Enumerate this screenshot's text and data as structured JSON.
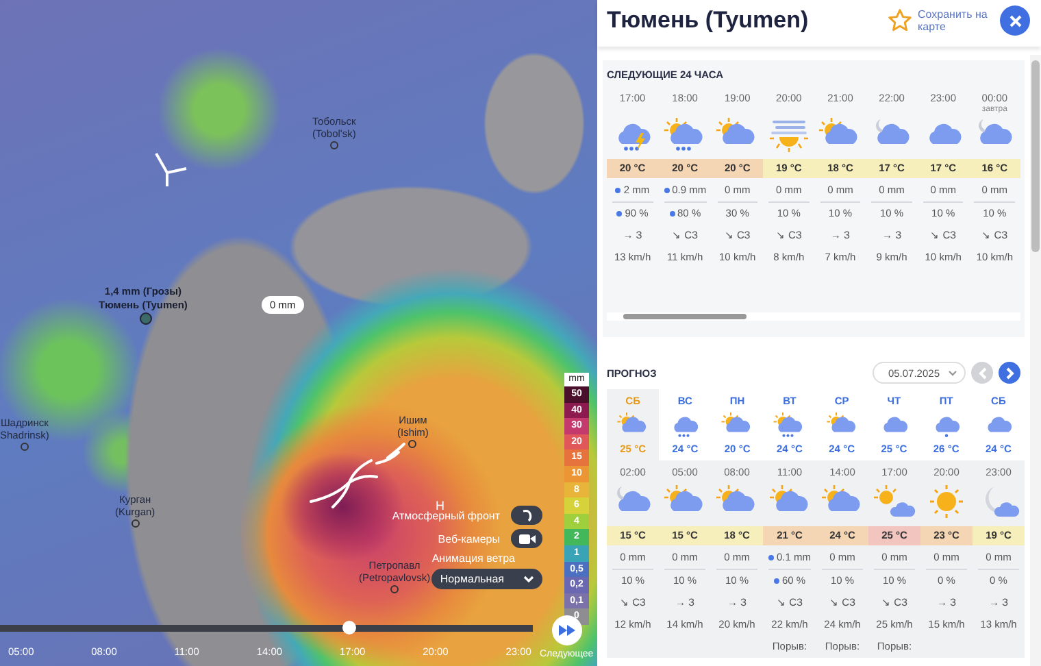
{
  "map": {
    "cities": [
      {
        "name": "Тобольск",
        "latin": "(Tobol'sk)"
      },
      {
        "name": "Ишим",
        "latin": "(Ishim)"
      },
      {
        "name": "Курган",
        "latin": "(Kurgan)"
      },
      {
        "name": "Шадринск",
        "latin": "Shadrinsk)"
      },
      {
        "name": "Петропавл",
        "latin": "(Petropavlovsk)"
      }
    ],
    "point": {
      "value": "1,4 mm (Грозы)",
      "name": "Тюмень (Tyumen)"
    },
    "bubble": "0 mm",
    "pressure_mark": "Н",
    "legend": {
      "unit": "mm",
      "levels": [
        {
          "label": "50",
          "color": "#4a0f2a"
        },
        {
          "label": "40",
          "color": "#8e1b4f"
        },
        {
          "label": "30",
          "color": "#c53a6d"
        },
        {
          "label": "20",
          "color": "#e0585a"
        },
        {
          "label": "15",
          "color": "#e6733d"
        },
        {
          "label": "10",
          "color": "#eb9535"
        },
        {
          "label": "8",
          "color": "#e9b43a"
        },
        {
          "label": "6",
          "color": "#d6d23a"
        },
        {
          "label": "4",
          "color": "#9fcf3c"
        },
        {
          "label": "2",
          "color": "#43b85a"
        },
        {
          "label": "1",
          "color": "#3aa3b5"
        },
        {
          "label": "0,5",
          "color": "#4c6fc0"
        },
        {
          "label": "0,2",
          "color": "#6a68b0"
        },
        {
          "label": "0,1",
          "color": "#7a72a8"
        },
        {
          "label": "0",
          "color": "#8d8d92"
        }
      ]
    },
    "layers": [
      {
        "label": "Атмосферный фронт",
        "kind": "front"
      },
      {
        "label": "Веб-камеры",
        "kind": "camera"
      }
    ],
    "wind_animation": {
      "label": "Анимация ветра",
      "value": "Нормальная"
    },
    "timeline": {
      "ticks": [
        "05:00",
        "08:00",
        "11:00",
        "14:00",
        "17:00",
        "20:00",
        "23:00"
      ],
      "level": 0.655,
      "next_label": "Следующее"
    }
  },
  "panel": {
    "title": "Тюмень (Tyumen)",
    "save_link": "Сохранить на карте",
    "next24": {
      "title": "СЛЕДУЮЩИЕ 24 ЧАСА",
      "hours": [
        {
          "time": "17:00",
          "kind": "storm",
          "temp": "20 °C",
          "color": "#f5d6b4",
          "precip": "2 mm",
          "precip_drop": true,
          "prob": "90 %",
          "prob_drop": true,
          "wind": "→ З",
          "speed": "13 km/h"
        },
        {
          "time": "18:00",
          "kind": "sun-cloud-rain",
          "temp": "20 °C",
          "color": "#f5d6b4",
          "precip": "0.9 mm",
          "precip_drop": true,
          "prob": "80 %",
          "prob_drop": true,
          "wind": "↘ СЗ",
          "speed": "11 km/h"
        },
        {
          "time": "19:00",
          "kind": "sun-cloud",
          "temp": "20 °C",
          "color": "#f5d6b4",
          "precip": "0 mm",
          "precip_drop": false,
          "prob": "30 %",
          "prob_drop": false,
          "wind": "↘ СЗ",
          "speed": "10 km/h"
        },
        {
          "time": "20:00",
          "kind": "fog-sun",
          "temp": "19 °C",
          "color": "#f6eebb",
          "precip": "0 mm",
          "precip_drop": false,
          "prob": "10 %",
          "prob_drop": false,
          "wind": "↘ СЗ",
          "speed": "8 km/h"
        },
        {
          "time": "21:00",
          "kind": "sun-cloud",
          "temp": "18 °C",
          "color": "#f6eebb",
          "precip": "0 mm",
          "precip_drop": false,
          "prob": "10 %",
          "prob_drop": false,
          "wind": "→ З",
          "speed": "7 km/h"
        },
        {
          "time": "22:00",
          "kind": "moon-cloud",
          "temp": "17 °C",
          "color": "#f6eebb",
          "precip": "0 mm",
          "precip_drop": false,
          "prob": "10 %",
          "prob_drop": false,
          "wind": "→ З",
          "speed": "9 km/h"
        },
        {
          "time": "23:00",
          "kind": "cloud",
          "temp": "17 °C",
          "color": "#f6eebb",
          "precip": "0 mm",
          "precip_drop": false,
          "prob": "10 %",
          "prob_drop": false,
          "wind": "↘ СЗ",
          "speed": "10 km/h"
        },
        {
          "time": "00:00",
          "sub": "завтра",
          "kind": "moon-cloud",
          "temp": "16 °C",
          "color": "#f6eebb",
          "precip": "0 mm",
          "precip_drop": false,
          "prob": "10 %",
          "prob_drop": false,
          "wind": "↘ СЗ",
          "speed": "10 km/h"
        }
      ]
    },
    "forecast": {
      "title": "ПРОГНОЗ",
      "date": "05.07.2025",
      "prev_disabled": true,
      "days": [
        {
          "label": "СБ",
          "kind": "sun-cloud",
          "temp": "25 °C",
          "selected": true
        },
        {
          "label": "ВС",
          "kind": "cloud-rain",
          "temp": "24 °C",
          "selected": false
        },
        {
          "label": "ПН",
          "kind": "sun-cloud",
          "temp": "20 °C",
          "selected": false
        },
        {
          "label": "ВТ",
          "kind": "sun-cloud-rain",
          "temp": "24 °C",
          "selected": false
        },
        {
          "label": "СР",
          "kind": "sun-cloud",
          "temp": "24 °C",
          "selected": false
        },
        {
          "label": "ЧТ",
          "kind": "cloud",
          "temp": "25 °C",
          "selected": false
        },
        {
          "label": "ПТ",
          "kind": "cloud-drop",
          "temp": "26 °C",
          "selected": false
        },
        {
          "label": "СБ",
          "kind": "cloud",
          "temp": "24 °C",
          "selected": false
        }
      ],
      "hours": [
        {
          "time": "02:00",
          "kind": "moon-cloud",
          "temp": "15 °C",
          "color": "#f6eebb",
          "precip": "0 mm",
          "precip_drop": false,
          "prob": "10 %",
          "prob_drop": false,
          "wind": "↘ СЗ",
          "speed": "12 km/h"
        },
        {
          "time": "05:00",
          "kind": "sun-cloud",
          "temp": "15 °C",
          "color": "#f6eebb",
          "precip": "0 mm",
          "precip_drop": false,
          "prob": "10 %",
          "prob_drop": false,
          "wind": "→ З",
          "speed": "14 km/h"
        },
        {
          "time": "08:00",
          "kind": "sun-cloud",
          "temp": "18 °C",
          "color": "#f6eebb",
          "precip": "0 mm",
          "precip_drop": false,
          "prob": "10 %",
          "prob_drop": false,
          "wind": "→ З",
          "speed": "20 km/h"
        },
        {
          "time": "11:00",
          "kind": "sun-cloud",
          "temp": "21 °C",
          "color": "#f5d6b4",
          "precip": "0.1 mm",
          "precip_drop": true,
          "prob": "60 %",
          "prob_drop": true,
          "wind": "↘ СЗ",
          "speed": "22 km/h",
          "gust": "Порыв:"
        },
        {
          "time": "14:00",
          "kind": "sun-cloud",
          "temp": "24 °C",
          "color": "#f5d6b4",
          "precip": "0 mm",
          "precip_drop": false,
          "prob": "10 %",
          "prob_drop": false,
          "wind": "↘ СЗ",
          "speed": "24 km/h",
          "gust": "Порыв:"
        },
        {
          "time": "17:00",
          "kind": "sun-small-cloud",
          "temp": "25 °C",
          "color": "#f3c5bf",
          "precip": "0 mm",
          "precip_drop": false,
          "prob": "10 %",
          "prob_drop": false,
          "wind": "↘ СЗ",
          "speed": "25 km/h",
          "gust": "Порыв:"
        },
        {
          "time": "20:00",
          "kind": "sun",
          "temp": "23 °C",
          "color": "#f5d6b4",
          "precip": "0 mm",
          "precip_drop": false,
          "prob": "0 %",
          "prob_drop": false,
          "wind": "→ З",
          "speed": "15 km/h"
        },
        {
          "time": "23:00",
          "kind": "moon",
          "temp": "19 °C",
          "color": "#f6eebb",
          "precip": "0 mm",
          "precip_drop": false,
          "prob": "0 %",
          "prob_drop": false,
          "wind": "→ З",
          "speed": "13 km/h"
        }
      ]
    }
  }
}
